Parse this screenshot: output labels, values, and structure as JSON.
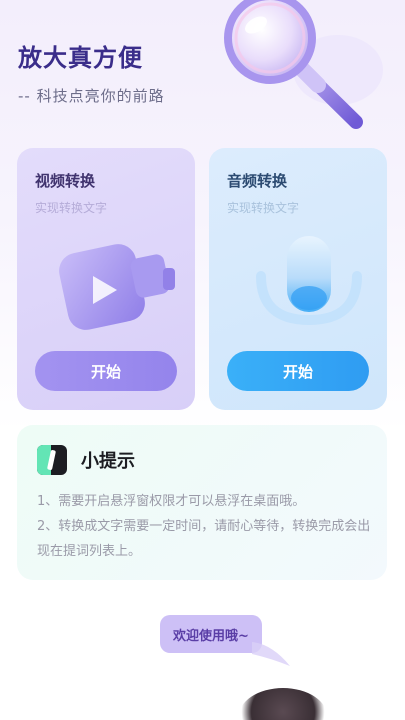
{
  "header": {
    "title": "放大真方便",
    "subtitle": "-- 科技点亮你的前路"
  },
  "cards": {
    "video": {
      "title": "视频转换",
      "subtitle": "实现转换文字",
      "button_label": "开始",
      "icon": "video-camera-icon"
    },
    "audio": {
      "title": "音频转换",
      "subtitle": "实现转换文字",
      "button_label": "开始",
      "icon": "microphone-icon"
    }
  },
  "tips": {
    "title": "小提示",
    "items": [
      "1、需要开启悬浮窗权限才可以悬浮在桌面哦。",
      "2、转换成文字需要一定时间，请耐心等待，转换完成会出现在提词列表上。"
    ]
  },
  "welcome": {
    "text": "欢迎使用哦~"
  },
  "colors": {
    "brand_title": "#3a2d8a",
    "video_button": "#9a8bee",
    "audio_button": "#34a6f5",
    "tips_accent": "#63e5b5",
    "welcome_bubble": "#cdc0f6"
  }
}
